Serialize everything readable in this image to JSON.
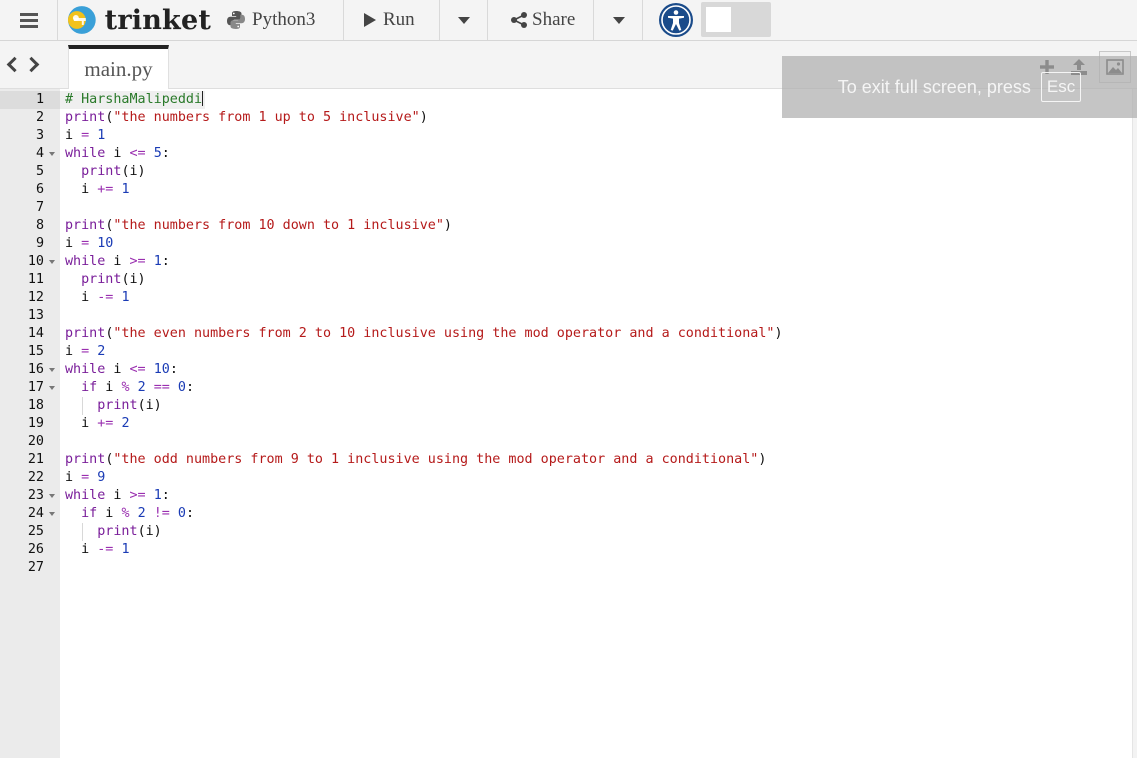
{
  "app": {
    "brand": "trinket",
    "language": "Python3",
    "run_label": "Run",
    "share_label": "Share"
  },
  "tabs": {
    "active_file": "main.py"
  },
  "fullscreen_notice": {
    "text": "To exit full screen, press",
    "key": "Esc"
  },
  "colors": {
    "comment": "#2a7a2a",
    "keyword": "#7a1e9a",
    "string": "#b51a1a",
    "number": "#1a3bb5",
    "accent_access": "#1a4b8a"
  },
  "icons": [
    "menu-icon",
    "trinket-logo-icon",
    "python-icon",
    "play-icon",
    "share-icon",
    "caret-down-icon",
    "accessibility-icon",
    "chevron-left-icon",
    "chevron-right-icon",
    "plus-icon",
    "upload-icon",
    "image-icon"
  ],
  "editor": {
    "active_line": 1,
    "fold_lines": [
      4,
      10,
      16,
      17,
      23,
      24
    ],
    "lines": [
      [
        {
          "t": "com",
          "v": "# HarshaMalipeddi"
        }
      ],
      [
        {
          "t": "bi",
          "v": "print"
        },
        {
          "t": "var",
          "v": "("
        },
        {
          "t": "str",
          "v": "\"the numbers from 1 up to 5 inclusive\""
        },
        {
          "t": "var",
          "v": ")"
        }
      ],
      [
        {
          "t": "var",
          "v": "i "
        },
        {
          "t": "op",
          "v": "="
        },
        {
          "t": "var",
          "v": " "
        },
        {
          "t": "num",
          "v": "1"
        }
      ],
      [
        {
          "t": "kw",
          "v": "while"
        },
        {
          "t": "var",
          "v": " i "
        },
        {
          "t": "op",
          "v": "<="
        },
        {
          "t": "var",
          "v": " "
        },
        {
          "t": "num",
          "v": "5"
        },
        {
          "t": "var",
          "v": ":"
        }
      ],
      [
        {
          "t": "var",
          "v": "  "
        },
        {
          "t": "bi",
          "v": "print"
        },
        {
          "t": "var",
          "v": "(i)"
        }
      ],
      [
        {
          "t": "var",
          "v": "  i "
        },
        {
          "t": "op",
          "v": "+="
        },
        {
          "t": "var",
          "v": " "
        },
        {
          "t": "num",
          "v": "1"
        }
      ],
      [],
      [
        {
          "t": "bi",
          "v": "print"
        },
        {
          "t": "var",
          "v": "("
        },
        {
          "t": "str",
          "v": "\"the numbers from 10 down to 1 inclusive\""
        },
        {
          "t": "var",
          "v": ")"
        }
      ],
      [
        {
          "t": "var",
          "v": "i "
        },
        {
          "t": "op",
          "v": "="
        },
        {
          "t": "var",
          "v": " "
        },
        {
          "t": "num",
          "v": "10"
        }
      ],
      [
        {
          "t": "kw",
          "v": "while"
        },
        {
          "t": "var",
          "v": " i "
        },
        {
          "t": "op",
          "v": ">="
        },
        {
          "t": "var",
          "v": " "
        },
        {
          "t": "num",
          "v": "1"
        },
        {
          "t": "var",
          "v": ":"
        }
      ],
      [
        {
          "t": "var",
          "v": "  "
        },
        {
          "t": "bi",
          "v": "print"
        },
        {
          "t": "var",
          "v": "(i)"
        }
      ],
      [
        {
          "t": "var",
          "v": "  i "
        },
        {
          "t": "op",
          "v": "-="
        },
        {
          "t": "var",
          "v": " "
        },
        {
          "t": "num",
          "v": "1"
        }
      ],
      [],
      [
        {
          "t": "bi",
          "v": "print"
        },
        {
          "t": "var",
          "v": "("
        },
        {
          "t": "str",
          "v": "\"the even numbers from 2 to 10 inclusive using the mod operator and a conditional\""
        },
        {
          "t": "var",
          "v": ")"
        }
      ],
      [
        {
          "t": "var",
          "v": "i "
        },
        {
          "t": "op",
          "v": "="
        },
        {
          "t": "var",
          "v": " "
        },
        {
          "t": "num",
          "v": "2"
        }
      ],
      [
        {
          "t": "kw",
          "v": "while"
        },
        {
          "t": "var",
          "v": " i "
        },
        {
          "t": "op",
          "v": "<="
        },
        {
          "t": "var",
          "v": " "
        },
        {
          "t": "num",
          "v": "10"
        },
        {
          "t": "var",
          "v": ":"
        }
      ],
      [
        {
          "t": "var",
          "v": "  "
        },
        {
          "t": "kw",
          "v": "if"
        },
        {
          "t": "var",
          "v": " i "
        },
        {
          "t": "op",
          "v": "%"
        },
        {
          "t": "var",
          "v": " "
        },
        {
          "t": "num",
          "v": "2"
        },
        {
          "t": "var",
          "v": " "
        },
        {
          "t": "op",
          "v": "=="
        },
        {
          "t": "var",
          "v": " "
        },
        {
          "t": "num",
          "v": "0"
        },
        {
          "t": "var",
          "v": ":"
        }
      ],
      [
        {
          "t": "var",
          "v": "    "
        },
        {
          "t": "bi",
          "v": "print"
        },
        {
          "t": "var",
          "v": "(i)"
        }
      ],
      [
        {
          "t": "var",
          "v": "  i "
        },
        {
          "t": "op",
          "v": "+="
        },
        {
          "t": "var",
          "v": " "
        },
        {
          "t": "num",
          "v": "2"
        }
      ],
      [],
      [
        {
          "t": "bi",
          "v": "print"
        },
        {
          "t": "var",
          "v": "("
        },
        {
          "t": "str",
          "v": "\"the odd numbers from 9 to 1 inclusive using the mod operator and a conditional\""
        },
        {
          "t": "var",
          "v": ")"
        }
      ],
      [
        {
          "t": "var",
          "v": "i "
        },
        {
          "t": "op",
          "v": "="
        },
        {
          "t": "var",
          "v": " "
        },
        {
          "t": "num",
          "v": "9"
        }
      ],
      [
        {
          "t": "kw",
          "v": "while"
        },
        {
          "t": "var",
          "v": " i "
        },
        {
          "t": "op",
          "v": ">="
        },
        {
          "t": "var",
          "v": " "
        },
        {
          "t": "num",
          "v": "1"
        },
        {
          "t": "var",
          "v": ":"
        }
      ],
      [
        {
          "t": "var",
          "v": "  "
        },
        {
          "t": "kw",
          "v": "if"
        },
        {
          "t": "var",
          "v": " i "
        },
        {
          "t": "op",
          "v": "%"
        },
        {
          "t": "var",
          "v": " "
        },
        {
          "t": "num",
          "v": "2"
        },
        {
          "t": "var",
          "v": " "
        },
        {
          "t": "op",
          "v": "!="
        },
        {
          "t": "var",
          "v": " "
        },
        {
          "t": "num",
          "v": "0"
        },
        {
          "t": "var",
          "v": ":"
        }
      ],
      [
        {
          "t": "var",
          "v": "    "
        },
        {
          "t": "bi",
          "v": "print"
        },
        {
          "t": "var",
          "v": "(i)"
        }
      ],
      [
        {
          "t": "var",
          "v": "  i "
        },
        {
          "t": "op",
          "v": "-="
        },
        {
          "t": "var",
          "v": " "
        },
        {
          "t": "num",
          "v": "1"
        }
      ],
      []
    ]
  }
}
